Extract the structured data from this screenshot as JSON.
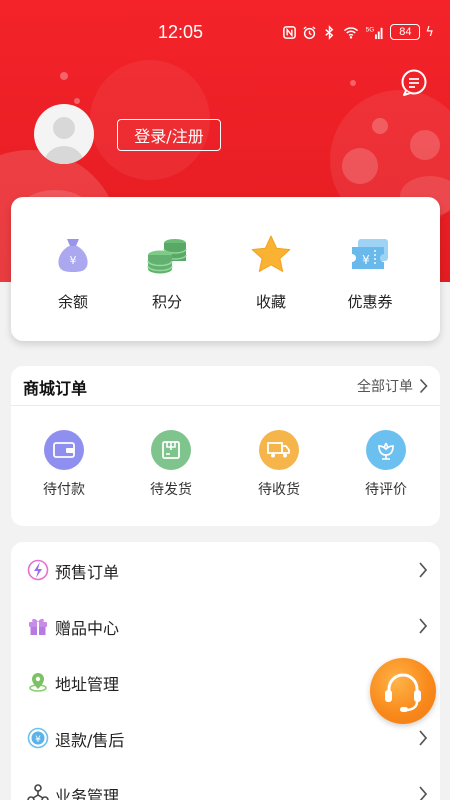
{
  "status_bar": {
    "time": "12:05",
    "battery": "84",
    "network": "5G"
  },
  "profile": {
    "login_label": "登录/注册"
  },
  "assets": [
    {
      "label": "余额",
      "icon": "money-bag-icon"
    },
    {
      "label": "积分",
      "icon": "coins-icon"
    },
    {
      "label": "收藏",
      "icon": "star-icon"
    },
    {
      "label": "优惠券",
      "icon": "coupon-icon"
    }
  ],
  "orders": {
    "title": "商城订单",
    "all_label": "全部订单",
    "items": [
      {
        "label": "待付款",
        "icon": "wallet-icon",
        "color": "#8f8ff0"
      },
      {
        "label": "待发货",
        "icon": "package-icon",
        "color": "#7ec48c"
      },
      {
        "label": "待收货",
        "icon": "truck-icon",
        "color": "#f5b54a"
      },
      {
        "label": "待评价",
        "icon": "flower-icon",
        "color": "#6cc0f0"
      }
    ]
  },
  "menu": [
    {
      "label": "预售订单",
      "icon": "lightning-icon"
    },
    {
      "label": "赠品中心",
      "icon": "gift-icon"
    },
    {
      "label": "地址管理",
      "icon": "location-icon"
    },
    {
      "label": "退款/售后",
      "icon": "refund-icon"
    },
    {
      "label": "业务管理",
      "icon": "network-icon"
    }
  ],
  "colors": {
    "brand_red": "#ea1f25",
    "service_orange": "#f98a1c"
  }
}
